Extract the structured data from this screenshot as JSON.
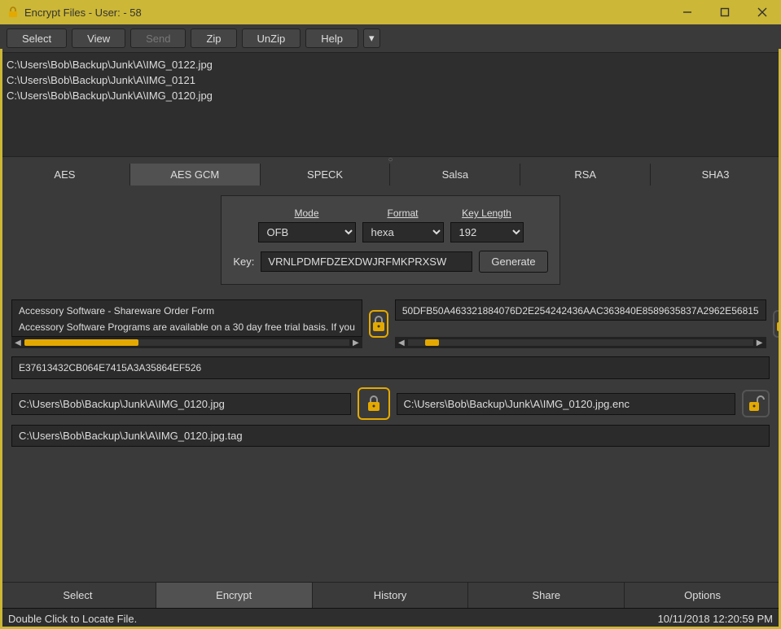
{
  "title": "Encrypt Files - User:  - 58",
  "toolbar": {
    "select": "Select",
    "view": "View",
    "send": "Send",
    "zip": "Zip",
    "unzip": "UnZip",
    "help": "Help"
  },
  "files": [
    "C:\\Users\\Bob\\Backup\\Junk\\A\\IMG_0122.jpg",
    "C:\\Users\\Bob\\Backup\\Junk\\A\\IMG_0121",
    "C:\\Users\\Bob\\Backup\\Junk\\A\\IMG_0120.jpg"
  ],
  "algo_tabs": [
    "AES",
    "AES GCM",
    "SPECK",
    "Salsa",
    "RSA",
    "SHA3"
  ],
  "algo_active": 1,
  "params": {
    "mode_label": "Mode",
    "mode_value": "OFB",
    "format_label": "Format",
    "format_value": "hexa",
    "keylen_label": "Key Length",
    "keylen_value": "192",
    "key_label": "Key:",
    "key_value": "VRNLPDMFDZEXDWJRFMKPRXSW",
    "generate": "Generate"
  },
  "preview_left_line1": "Accessory Software - Shareware Order Form",
  "preview_left_line2": "Accessory Software Programs are available on a 30 day free trial basis. If you",
  "cipher_preview": "50DFB50A463321884076D2E254242436AAC363840E8589635837A2962E56815",
  "hash_output": "E37613432CB064E7415A3A35864EF526",
  "infile": "C:\\Users\\Bob\\Backup\\Junk\\A\\IMG_0120.jpg",
  "outfile": "C:\\Users\\Bob\\Backup\\Junk\\A\\IMG_0120.jpg.enc",
  "tagfile": "C:\\Users\\Bob\\Backup\\Junk\\A\\IMG_0120.jpg.tag",
  "bottom_tabs": [
    "Select",
    "Encrypt",
    "History",
    "Share",
    "Options"
  ],
  "bottom_active": 1,
  "status_left": "Double Click to Locate File.",
  "status_right": "10/11/2018 12:20:59 PM"
}
